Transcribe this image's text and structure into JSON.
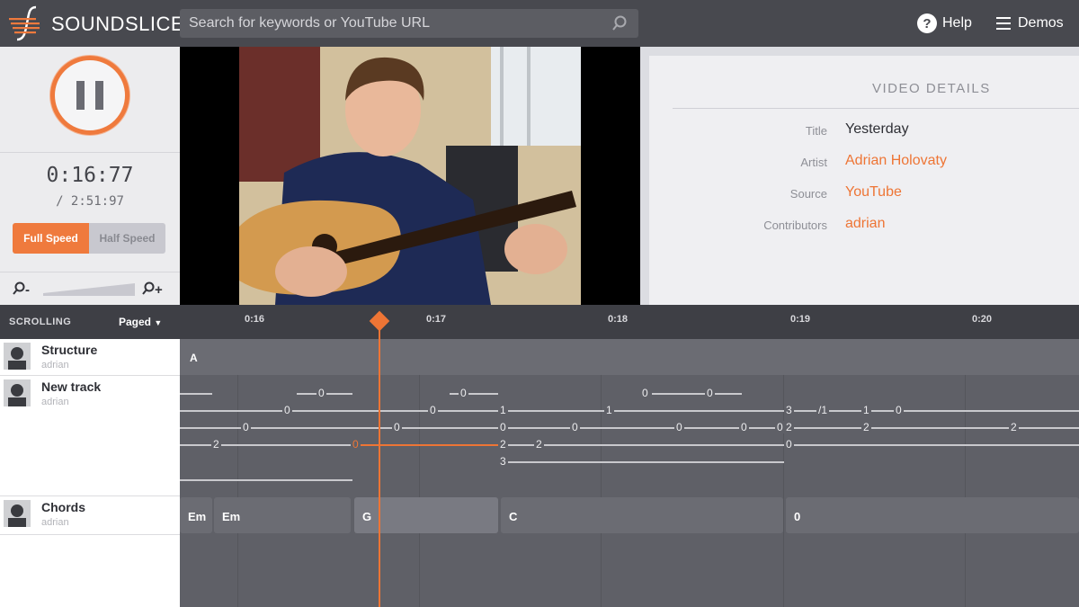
{
  "app": {
    "name": "SOUNDSLICE"
  },
  "search": {
    "placeholder": "Search for keywords or YouTube URL"
  },
  "nav": {
    "help": "Help",
    "demos": "Demos"
  },
  "player": {
    "current_time": "0:16:77",
    "total_time": "/ 2:51:97",
    "speed": {
      "full": "Full Speed",
      "half": "Half Speed",
      "selected": "Full Speed"
    },
    "zoom": {
      "out": "-",
      "in": "+"
    }
  },
  "details": {
    "heading": "VIDEO DETAILS",
    "fields": [
      {
        "label": "Title",
        "value": "Yesterday"
      },
      {
        "label": "Artist",
        "value": "Adrian Holovaty"
      },
      {
        "label": "Source",
        "value": "YouTube"
      },
      {
        "label": "Contributors",
        "value": "adrian"
      }
    ]
  },
  "scrolling": {
    "label": "SCROLLING",
    "mode": "Paged"
  },
  "timeline": {
    "ticks": [
      "0:16",
      "0:17",
      "0:18",
      "0:19",
      "0:20"
    ]
  },
  "tracks": [
    {
      "name": "Structure",
      "user": "adrian"
    },
    {
      "name": "New track",
      "user": "adrian"
    },
    {
      "name": "Chords",
      "user": "adrian"
    }
  ],
  "structure": {
    "section": "A"
  },
  "tab": {
    "frets": [
      {
        "string": 1,
        "text": "0"
      },
      {
        "string": 1,
        "text": "0"
      },
      {
        "string": 1,
        "text": "0"
      },
      {
        "string": 1,
        "text": "0"
      },
      {
        "string": 2,
        "text": "0"
      },
      {
        "string": 2,
        "text": "0"
      },
      {
        "string": 2,
        "text": "1"
      },
      {
        "string": 2,
        "text": "1"
      },
      {
        "string": 2,
        "text": "3"
      },
      {
        "string": 2,
        "text": "/1"
      },
      {
        "string": 2,
        "text": "1"
      },
      {
        "string": 2,
        "text": "0"
      },
      {
        "string": 3,
        "text": "0"
      },
      {
        "string": 3,
        "text": "0"
      },
      {
        "string": 3,
        "text": "0"
      },
      {
        "string": 3,
        "text": "0"
      },
      {
        "string": 3,
        "text": "0"
      },
      {
        "string": 3,
        "text": "0"
      },
      {
        "string": 3,
        "text": "0"
      },
      {
        "string": 3,
        "text": "2"
      },
      {
        "string": 3,
        "text": "2"
      },
      {
        "string": 3,
        "text": "2"
      },
      {
        "string": 4,
        "text": "2"
      },
      {
        "string": 4,
        "text": "0"
      },
      {
        "string": 4,
        "text": "2"
      },
      {
        "string": 4,
        "text": "2"
      },
      {
        "string": 4,
        "text": "0"
      },
      {
        "string": 5,
        "text": "3"
      }
    ]
  },
  "chords": [
    "Em",
    "Em",
    "G",
    "C",
    "0"
  ],
  "colors": {
    "accent": "#ee7535",
    "topbar": "#48494f",
    "grid": "#5f6067"
  }
}
